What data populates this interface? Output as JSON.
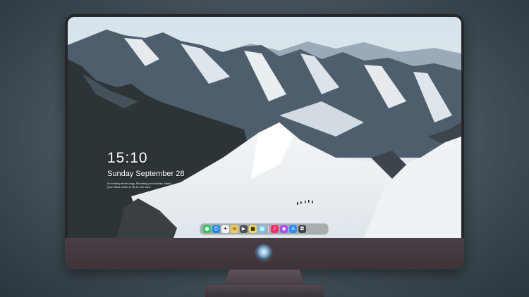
{
  "lock_screen": {
    "time": "15:10",
    "date": "Sunday September 28",
    "tagline_line1": "Innovating technology, Elevating productivity. Make",
    "tagline_line2": "your ideas come to life in one click."
  },
  "dock": {
    "items": [
      {
        "name": "messages-icon",
        "glyph": "●",
        "color": "#34c759"
      },
      {
        "name": "finder-icon",
        "glyph": "☺",
        "color": "#1e88e5"
      },
      {
        "name": "safari-icon",
        "glyph": "✦",
        "color": "#eef2f5"
      },
      {
        "name": "notes-icon",
        "glyph": "≡",
        "color": "#f2c94c"
      },
      {
        "name": "clapper-icon",
        "glyph": "▶",
        "color": "#4a4f57"
      },
      {
        "name": "stickies-icon",
        "glyph": "■",
        "color": "#f7d94c"
      },
      {
        "name": "photos-icon",
        "glyph": "▦",
        "color": "#7cc4f0"
      },
      {
        "name": "music-icon",
        "glyph": "♪",
        "color": "#fa2d6a"
      },
      {
        "name": "podcasts-icon",
        "glyph": "◉",
        "color": "#a54df5"
      },
      {
        "name": "app-store-icon",
        "glyph": "A",
        "color": "#2f8cff"
      },
      {
        "name": "screenshot-icon",
        "glyph": "◘",
        "color": "#3c4046"
      }
    ]
  }
}
